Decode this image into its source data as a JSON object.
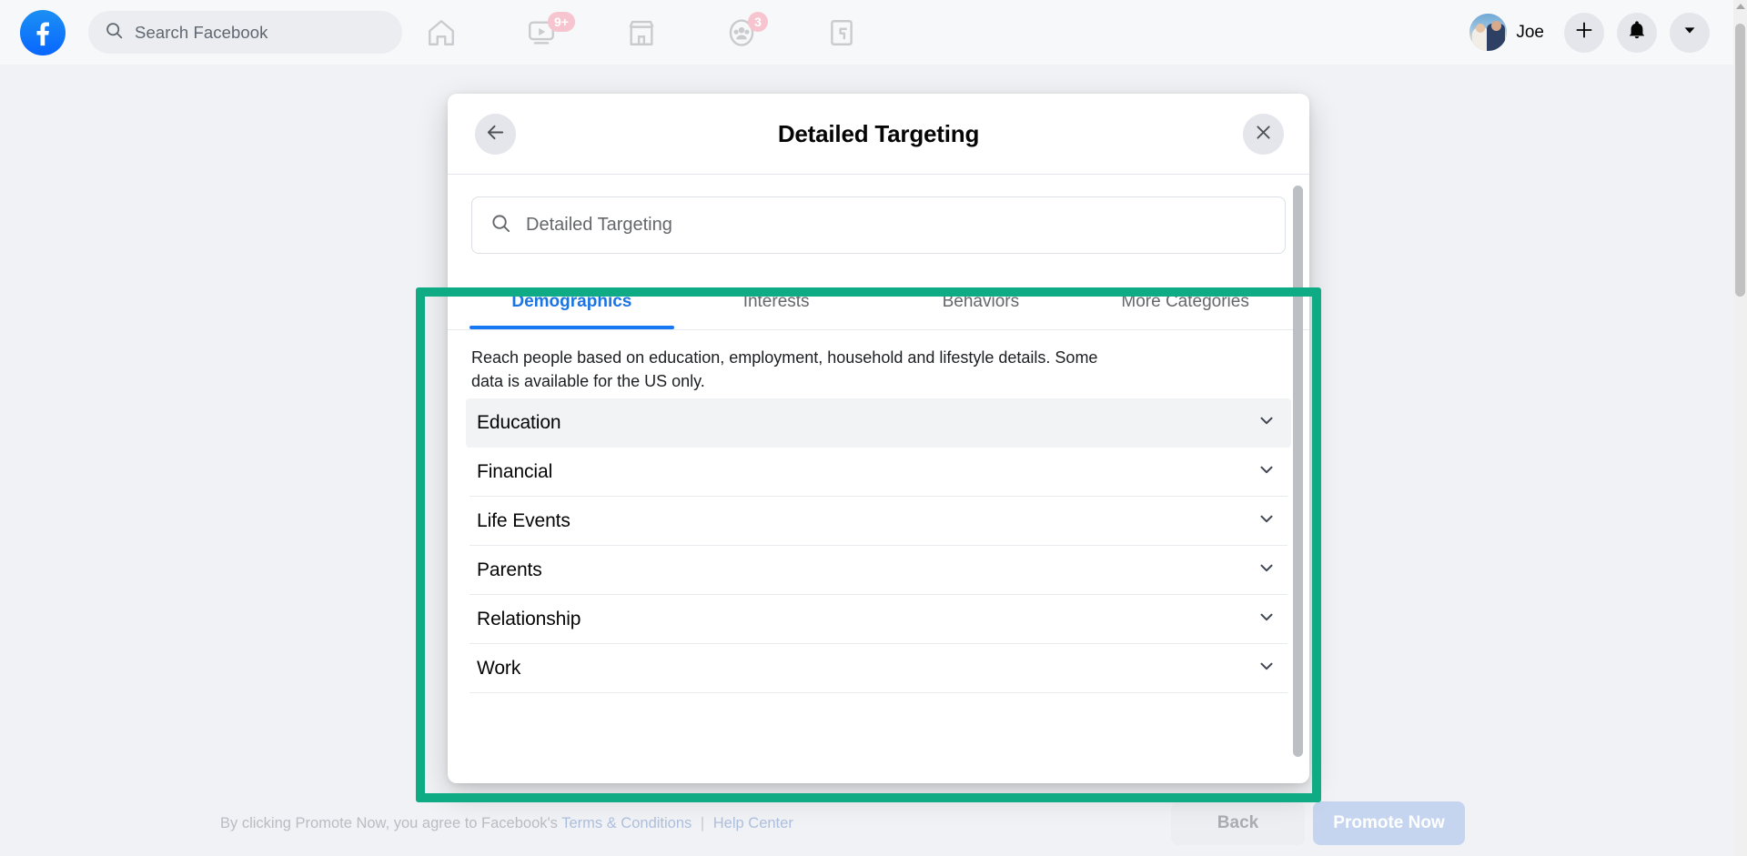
{
  "topbar": {
    "logo": "facebook-logo",
    "search": {
      "placeholder": "Search Facebook",
      "icon": "search-icon"
    },
    "nav": [
      {
        "name": "home",
        "icon": "home-icon",
        "badge": null
      },
      {
        "name": "video",
        "icon": "video-icon",
        "badge": "9+"
      },
      {
        "name": "marketplace",
        "icon": "marketplace-icon",
        "badge": null
      },
      {
        "name": "groups",
        "icon": "groups-icon",
        "badge": "3"
      },
      {
        "name": "gaming",
        "icon": "gaming-icon",
        "badge": null
      }
    ],
    "profile": {
      "name": "Joe",
      "avatar": "user-avatar"
    },
    "actions": [
      {
        "name": "create",
        "icon": "plus-icon"
      },
      {
        "name": "notifications",
        "icon": "bell-icon"
      },
      {
        "name": "account-menu",
        "icon": "chevron-down-icon"
      }
    ]
  },
  "modal": {
    "title": "Detailed Targeting",
    "back_icon": "arrow-left-icon",
    "close_icon": "close-icon",
    "search": {
      "placeholder": "Detailed Targeting",
      "value": "",
      "icon": "search-icon"
    },
    "tabs": [
      {
        "label": "Demographics",
        "active": true
      },
      {
        "label": "Interests",
        "active": false
      },
      {
        "label": "Behaviors",
        "active": false
      },
      {
        "label": "More Categories",
        "active": false
      }
    ],
    "description": "Reach people based on education, employment, household and lifestyle details. Some data is available for the US only.",
    "categories": [
      {
        "label": "Education",
        "chevron": "chevron-down-icon",
        "hovered": true
      },
      {
        "label": "Financial",
        "chevron": "chevron-down-icon",
        "hovered": false
      },
      {
        "label": "Life Events",
        "chevron": "chevron-down-icon",
        "hovered": false
      },
      {
        "label": "Parents",
        "chevron": "chevron-down-icon",
        "hovered": false
      },
      {
        "label": "Relationship",
        "chevron": "chevron-down-icon",
        "hovered": false
      },
      {
        "label": "Work",
        "chevron": "chevron-down-icon",
        "hovered": false
      }
    ]
  },
  "footer": {
    "note_prefix": "By clicking Promote Now, you agree to Facebook's",
    "terms_link": "Terms & Conditions",
    "separator": "|",
    "help_link": "Help Center",
    "back_label": "Back",
    "promote_label": "Promote Now"
  },
  "annotation": {
    "color": "#0eab84"
  },
  "colors": {
    "accent_blue": "#1877f2",
    "badge_pink": "#f6c5d0",
    "annotation_teal": "#0eab84",
    "promote_blue": "#c5d4ef"
  }
}
